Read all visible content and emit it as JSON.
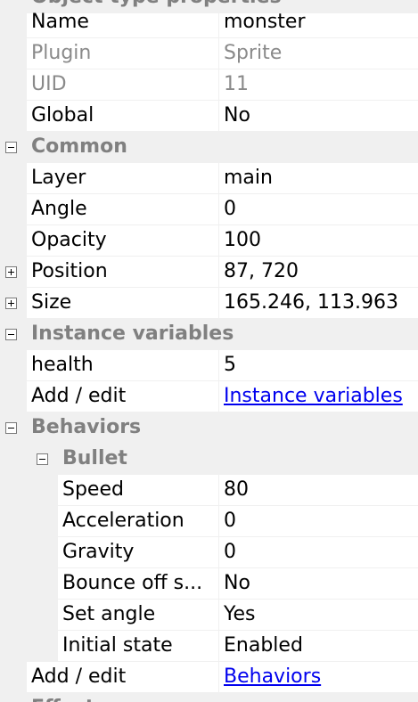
{
  "top_category": {
    "label": "Object type properties"
  },
  "rows_object": [
    {
      "name": "Name",
      "value": "monster"
    },
    {
      "name": "Plugin",
      "value": "Sprite"
    },
    {
      "name": "UID",
      "value": "11"
    },
    {
      "name": "Global",
      "value": "No"
    }
  ],
  "common": {
    "label": "Common",
    "rows": [
      {
        "name": "Layer",
        "value": "main"
      },
      {
        "name": "Angle",
        "value": "0"
      },
      {
        "name": "Opacity",
        "value": "100"
      },
      {
        "name": "Position",
        "value": "87, 720"
      },
      {
        "name": "Size",
        "value": "165.246, 113.963"
      }
    ]
  },
  "instance_variables": {
    "label": "Instance variables",
    "rows": [
      {
        "name": "health",
        "value": "5"
      },
      {
        "name": "Add / edit",
        "value": "Instance variables"
      }
    ]
  },
  "behaviors": {
    "label": "Behaviors",
    "bullet": {
      "label": "Bullet",
      "rows": [
        {
          "name": "Speed",
          "value": "80"
        },
        {
          "name": "Acceleration",
          "value": "0"
        },
        {
          "name": "Gravity",
          "value": "0"
        },
        {
          "name": "Bounce off s...",
          "value": "No"
        },
        {
          "name": "Set angle",
          "value": "Yes"
        },
        {
          "name": "Initial state",
          "value": "Enabled"
        }
      ]
    },
    "add_edit": {
      "name": "Add / edit",
      "value": "Behaviors"
    }
  },
  "bottom_category": {
    "label": "Effects"
  },
  "colors": {
    "gutter": "#f0f0f0",
    "category_text": "#808080",
    "readonly_text": "#8a8a8a",
    "link": "#0000ee"
  }
}
